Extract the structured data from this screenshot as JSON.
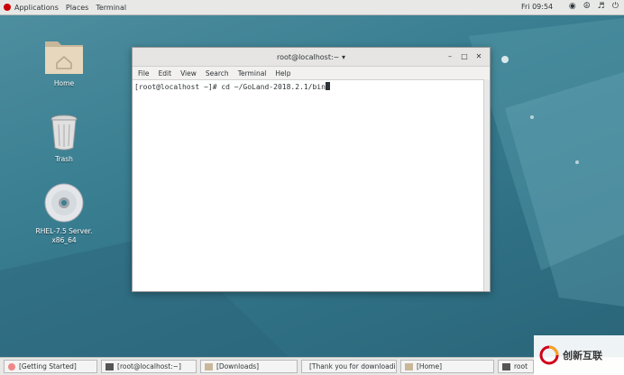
{
  "topbar": {
    "applications": "Applications",
    "places": "Places",
    "terminal": "Terminal",
    "clock": "Fri 09:54"
  },
  "desktop": {
    "home_label": "Home",
    "trash_label": "Trash",
    "disc_label_line1": "RHEL-7.5 Server.",
    "disc_label_line2": "x86_64"
  },
  "terminal": {
    "title": "root@localhost:~",
    "menu": [
      "File",
      "Edit",
      "View",
      "Search",
      "Terminal",
      "Help"
    ],
    "prompt_line": "[root@localhost ~]# cd ~/GoLand-2018.2.1/bin"
  },
  "taskbar": {
    "items": [
      "[Getting Started]",
      "root@localhost:~",
      "[Downloads]",
      "[Thank you for downloadi...",
      "[Home]",
      "root"
    ]
  },
  "watermark": {
    "brand": "创新互联"
  },
  "colors": {
    "wallpaper": "#3a7f92",
    "topbar": "#e8e8e7",
    "redhat": "#cc0000"
  }
}
